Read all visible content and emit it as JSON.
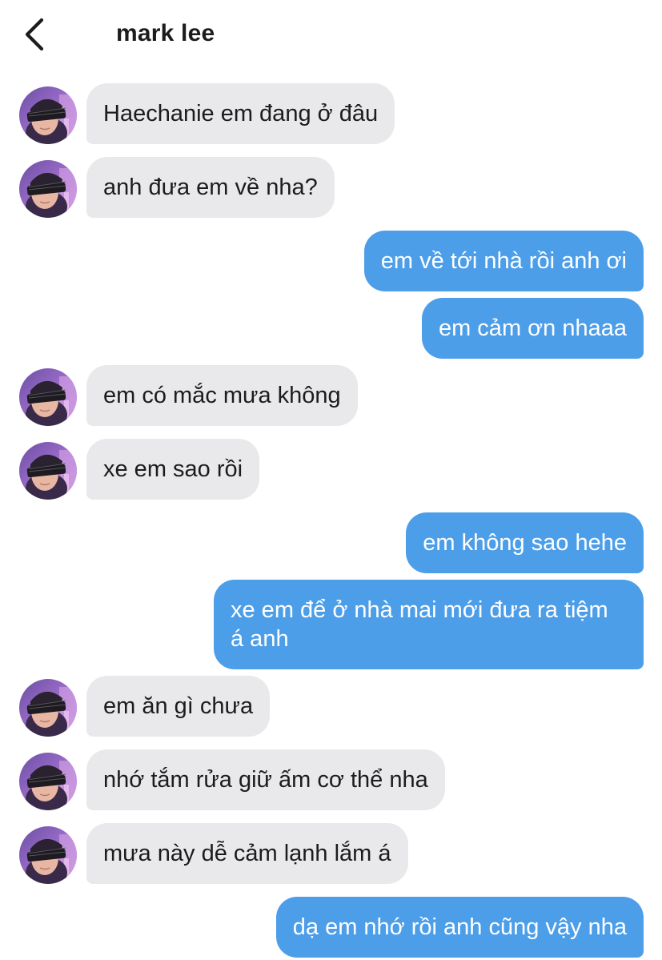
{
  "header": {
    "title": "mark lee",
    "back_icon": "chevron-left-icon"
  },
  "colors": {
    "incoming_bubble": "#e9e9eb",
    "outgoing_bubble": "#4d9ee9",
    "incoming_text": "#1c1c1e",
    "outgoing_text": "#ffffff"
  },
  "messages": [
    {
      "from": "contact",
      "text": "Haechanie em đang ở đâu"
    },
    {
      "from": "contact",
      "text": "anh đưa em về nha?"
    },
    {
      "from": "me",
      "text": "em về tới nhà rồi anh ơi"
    },
    {
      "from": "me",
      "text": "em cảm ơn nhaaa"
    },
    {
      "from": "contact",
      "text": "em có mắc mưa không"
    },
    {
      "from": "contact",
      "text": "xe em sao rồi"
    },
    {
      "from": "me",
      "text": "em không sao hehe"
    },
    {
      "from": "me",
      "text": "xe em để ở nhà mai mới đưa ra tiệm á anh"
    },
    {
      "from": "contact",
      "text": "em ăn gì chưa"
    },
    {
      "from": "contact",
      "text": "nhớ tắm rửa giữ ấm cơ thể nha"
    },
    {
      "from": "contact",
      "text": "mưa này dễ cảm lạnh lắm á"
    },
    {
      "from": "me",
      "text": "dạ em nhớ rồi anh cũng vậy nha"
    }
  ]
}
